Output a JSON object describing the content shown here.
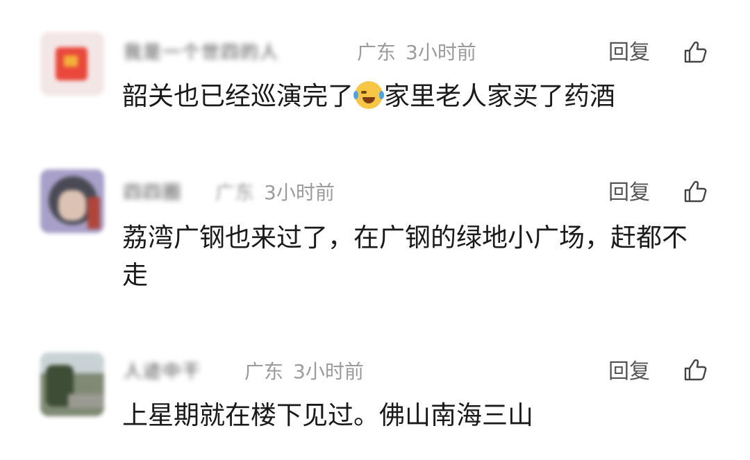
{
  "comments": [
    {
      "username": "我是一个世四的人",
      "location": "广东",
      "time": "3小时前",
      "reply_label": "回复",
      "text_before_emoji": "韶关也已经巡演完了",
      "emoji": "laughing-crying-emoji",
      "text_after_emoji": "家里老人家买了药酒"
    },
    {
      "username": "四四圈",
      "location": "广东",
      "time": "3小时前",
      "reply_label": "回复",
      "text": "荔湾广钢也来过了，在广钢的绿地小广场，赶都不走"
    },
    {
      "username": "人迹中干",
      "location": "广东",
      "time": "3小时前",
      "reply_label": "回复",
      "text": "上星期就在楼下见过。佛山南海三山"
    }
  ],
  "colors": {
    "text": "#1a1a1a",
    "meta": "#9b9b9b",
    "reply": "#555555",
    "emoji": "#f6c644"
  }
}
